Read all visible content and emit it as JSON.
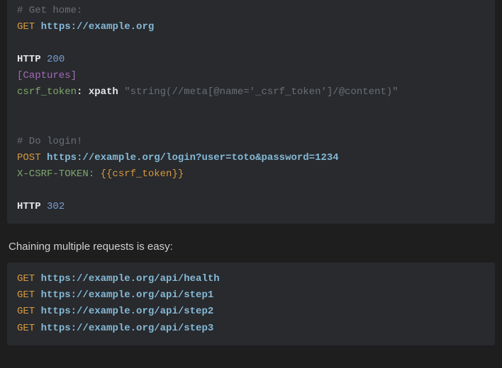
{
  "code1": {
    "c0": "# Get home:",
    "m0": "GET",
    "u0": "https://example.org",
    "http0": "HTTP",
    "s0": "200",
    "sec0": "[Captures]",
    "k0": "csrf_token",
    "colon0": ":",
    "f0": "xpath",
    "str0": "\"string(//meta[@name='_csrf_token']/@content)\"",
    "c1": "# Do login!",
    "m1": "POST",
    "u1": "https://example.org/login?user=toto&password=1234",
    "hdr0": "X-CSRF-TOKEN:",
    "tmpl0": "{{csrf_token}}",
    "http1": "HTTP",
    "s1": "302"
  },
  "prose": {
    "text": "Chaining multiple requests is easy:"
  },
  "code2": {
    "m0": "GET",
    "u0": "https://example.org/api/health",
    "m1": "GET",
    "u1": "https://example.org/api/step1",
    "m2": "GET",
    "u2": "https://example.org/api/step2",
    "m3": "GET",
    "u3": "https://example.org/api/step3"
  }
}
